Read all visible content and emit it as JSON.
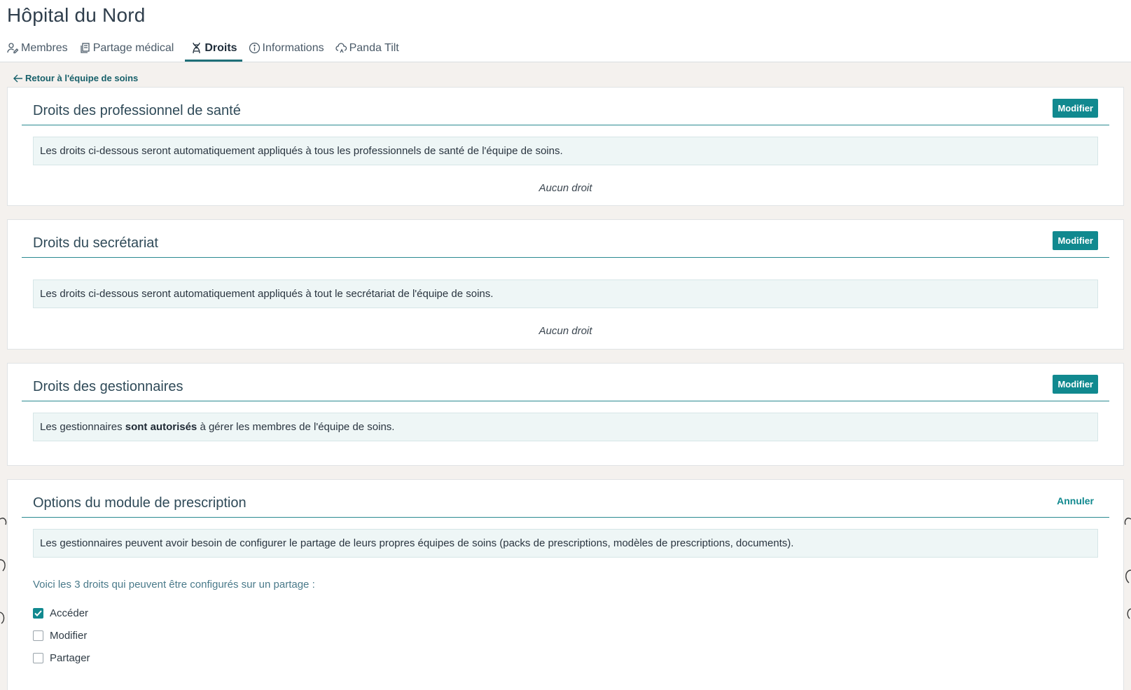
{
  "header": {
    "title": "Hôpital du Nord",
    "tabs": [
      {
        "label": "Membres",
        "icon": "user-pen-icon"
      },
      {
        "label": "Partage médical",
        "icon": "documents-icon"
      },
      {
        "label": "Droits",
        "icon": "dna-icon",
        "active": true
      },
      {
        "label": "Informations",
        "icon": "info-circle-icon"
      },
      {
        "label": "Panda Tilt",
        "icon": "cloud-sync-icon"
      }
    ]
  },
  "back_link": "Retour à l'équipe de soins",
  "cards": {
    "pro": {
      "title": "Droits des professionnel de santé",
      "button": "Modifier",
      "info": "Les droits ci-dessous seront automatiquement appliqués à tous les professionnels de santé de l'équipe de soins.",
      "empty": "Aucun droit"
    },
    "secretariat": {
      "title": "Droits du secrétariat",
      "button": "Modifier",
      "info": "Les droits ci-dessous seront automatiquement appliqués à tout le secrétariat de l'équipe de soins.",
      "empty": "Aucun droit"
    },
    "gestionnaires": {
      "title": "Droits des gestionnaires",
      "button": "Modifier",
      "info_before": "Les gestionnaires ",
      "info_bold": "sont autorisés",
      "info_after": " à gérer les membres de l'équipe de soins."
    },
    "prescription": {
      "title": "Options du module de prescription",
      "cancel": "Annuler",
      "info": "Les gestionnaires peuvent avoir besoin de configurer le partage de leurs propres équipes de soins (packs de prescriptions, modèles de prescriptions, documents).",
      "hint": "Voici les 3 droits qui peuvent être configurés sur un partage :",
      "options": [
        {
          "label": "Accéder",
          "checked": true
        },
        {
          "label": "Modifier",
          "checked": false
        },
        {
          "label": "Partager",
          "checked": false
        }
      ]
    }
  },
  "colors": {
    "accent": "#11898f",
    "background": "#f4f1ee",
    "info_bg": "#eef6f6"
  }
}
